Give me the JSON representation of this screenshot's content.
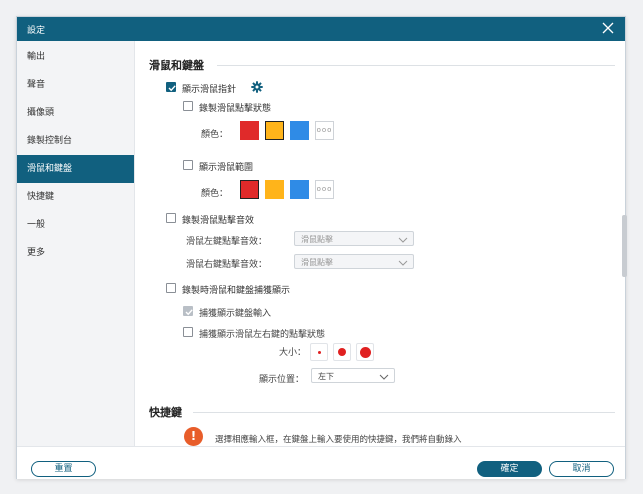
{
  "window": {
    "title": "設定"
  },
  "sidebar": {
    "items": [
      {
        "label": "輸出"
      },
      {
        "label": "聲音"
      },
      {
        "label": "攝像頭"
      },
      {
        "label": "錄製控制台"
      },
      {
        "label": "滑鼠和鍵盤"
      },
      {
        "label": "快捷鍵"
      },
      {
        "label": "一般"
      },
      {
        "label": "更多"
      }
    ],
    "active_index": 4
  },
  "mouse_section": {
    "title": "滑鼠和鍵盤",
    "show_pointer": {
      "label": "顯示滑鼠指針",
      "checked": true
    },
    "record_click": {
      "label": "錄製滑鼠點擊狀態",
      "checked": false
    },
    "color_label_1": "顏色：",
    "show_area": {
      "label": "顯示滑鼠範圍",
      "checked": false
    },
    "color_label_2": "顏色：",
    "swatches": {
      "red": "#e02a2a",
      "yellow": "#ffb41a",
      "blue": "#2f8be6",
      "more_text": "ooo"
    },
    "record_sound": {
      "label": "錄製滑鼠點擊音效",
      "checked": false
    },
    "left_sound": {
      "label": "滑鼠左鍵點擊音效：",
      "value": "滑鼠點擊"
    },
    "right_sound": {
      "label": "滑鼠右鍵點擊音效：",
      "value": "滑鼠點擊"
    },
    "capture_display": {
      "label": "錄製時滑鼠和鍵盤捕獲顯示",
      "checked": false
    },
    "capture_keyboard": {
      "label": "捕獲顯示鍵盤輸入",
      "checked": true
    },
    "capture_mouse": {
      "label": "捕獲顯示滑鼠左右鍵的點擊狀態",
      "checked": false
    },
    "size_label": "大小：",
    "position_label": "顯示位置：",
    "position_value": "左下"
  },
  "hotkey_section": {
    "title": "快捷鍵",
    "notice": "選擇相應輸入框，在鍵盤上輸入要使用的快捷鍵，我們將自動錄入"
  },
  "footer": {
    "reset": "重置",
    "ok": "確定",
    "cancel": "取消"
  },
  "colors": {
    "accent": "#11607f",
    "warning": "#e85d2a",
    "dot": "#e02020"
  }
}
